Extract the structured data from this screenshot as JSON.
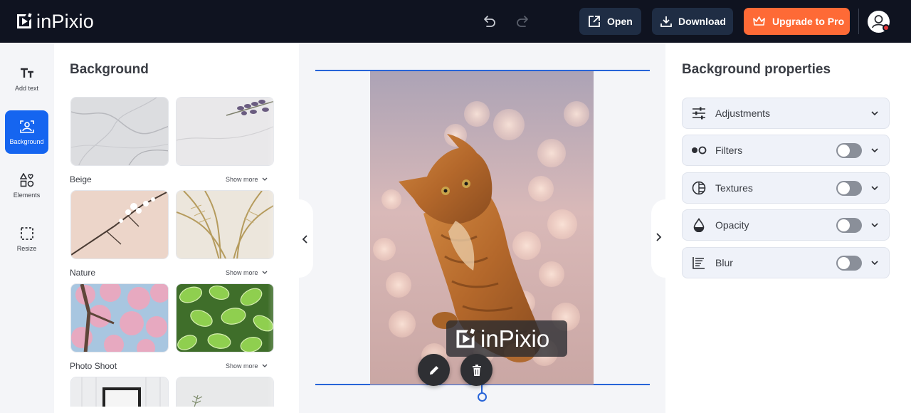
{
  "app": {
    "name": "inPixio"
  },
  "toolbar": {
    "open_label": "Open",
    "download_label": "Download",
    "upgrade_label": "Upgrade to Pro"
  },
  "rail": {
    "items": [
      {
        "label": "Add text",
        "icon": "text-icon",
        "active": false
      },
      {
        "label": "Background",
        "icon": "background-icon",
        "active": true
      },
      {
        "label": "Elements",
        "icon": "elements-icon",
        "active": false
      },
      {
        "label": "Resize",
        "icon": "resize-icon",
        "active": false
      }
    ]
  },
  "background_panel": {
    "title": "Background",
    "categories": [
      {
        "label": "Beige",
        "show_more": "Show more"
      },
      {
        "label": "Nature",
        "show_more": "Show more"
      },
      {
        "label": "Photo Shoot",
        "show_more": "Show more"
      }
    ]
  },
  "canvas": {
    "watermark_text": "inPixio"
  },
  "properties_panel": {
    "title": "Background properties",
    "items": [
      {
        "label": "Adjustments",
        "icon": "sliders-icon",
        "has_toggle": false,
        "enabled": false
      },
      {
        "label": "Filters",
        "icon": "filters-icon",
        "has_toggle": true,
        "enabled": false
      },
      {
        "label": "Textures",
        "icon": "textures-icon",
        "has_toggle": true,
        "enabled": false
      },
      {
        "label": "Opacity",
        "icon": "opacity-icon",
        "has_toggle": true,
        "enabled": false
      },
      {
        "label": "Blur",
        "icon": "blur-icon",
        "has_toggle": true,
        "enabled": false
      }
    ]
  },
  "colors": {
    "topbar": "#0f1320",
    "accent_blue": "#1565f0",
    "upgrade_orange": "#fe6a36"
  }
}
